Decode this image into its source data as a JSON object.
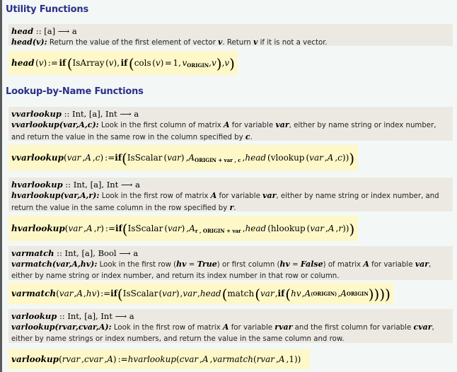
{
  "sections": [
    {
      "title": "Utility Functions",
      "functions": [
        {
          "name": "head",
          "signature": ":: [a] ⟶ a",
          "call": "head(v):",
          "description_parts": [
            {
              "text": " Return the value of the first element of vector ",
              "bold": false
            },
            {
              "text": "v",
              "bold": true
            },
            {
              "text": ".  Return ",
              "bold": false
            },
            {
              "text": "v",
              "bold": true
            },
            {
              "text": " if it is not a vector.",
              "bold": false
            }
          ],
          "definition": {
            "lhs": "head (v)",
            "assign": ":=",
            "rhs": "if (IsArray (v), if (cols (v) = 1, v_ORIGIN, v), v)",
            "subscript": "ORIGIN"
          }
        }
      ]
    },
    {
      "title": "Lookup-by-Name Functions",
      "functions": [
        {
          "name": "vvarlookup",
          "signature": ":: Int, [a], Int ⟶ a",
          "call": "vvarlookup(var,A,c):",
          "description_parts": [
            {
              "text": " Look in the first column of matrix ",
              "bold": false
            },
            {
              "text": "A",
              "bold": true
            },
            {
              "text": " for variable ",
              "bold": false
            },
            {
              "text": "var",
              "bold": true
            },
            {
              "text": ", either by name string or index number, and return the value in the same row in the column specified by ",
              "bold": false
            },
            {
              "text": "c",
              "bold": true
            },
            {
              "text": ".",
              "bold": false
            }
          ],
          "definition": {
            "lhs": "vvarlookup (var, A, c)",
            "assign": ":=",
            "rhs": "if (IsScalar (var), A_ORIGIN+var,c, head (vlookup (var, A, c)))",
            "subscript": "ORIGIN + var , c"
          }
        },
        {
          "name": "hvarlookup",
          "signature": ":: Int, [a], Int ⟶ a",
          "call": "hvarlookup(var,A,r):",
          "description_parts": [
            {
              "text": " Look in the first row of matrix ",
              "bold": false
            },
            {
              "text": "A",
              "bold": true
            },
            {
              "text": " for variable ",
              "bold": false
            },
            {
              "text": "var",
              "bold": true
            },
            {
              "text": ", either by name string or index number, and return the value in the same column in the row specified by ",
              "bold": false
            },
            {
              "text": "r",
              "bold": true
            },
            {
              "text": ".",
              "bold": false
            }
          ],
          "definition": {
            "lhs": "hvarlookup (var, A, r)",
            "assign": ":=",
            "rhs": "if (IsScalar (var), A_r,ORIGIN+var, head (hlookup (var, A, r)))",
            "subscript": "r , ORIGIN + var"
          }
        },
        {
          "name": "varmatch",
          "signature": ":: Int, [a], Bool ⟶ a",
          "call": "varmatch(var,A,hv):",
          "description_parts": [
            {
              "text": " Look in the first row (",
              "bold": false
            },
            {
              "text": "hv",
              "bold": true
            },
            {
              "text": " = ",
              "bold": false
            },
            {
              "text": "True",
              "bold": true
            },
            {
              "text": ") or first column (",
              "bold": false
            },
            {
              "text": "hv",
              "bold": true
            },
            {
              "text": " = ",
              "bold": false
            },
            {
              "text": "False",
              "bold": true
            },
            {
              "text": ") of matrix ",
              "bold": false
            },
            {
              "text": "A",
              "bold": true
            },
            {
              "text": " for variable ",
              "bold": false
            },
            {
              "text": "var",
              "bold": true
            },
            {
              "text": ", either by name string or index number, and return its index number in that row or column.",
              "bold": false
            }
          ],
          "definition": {
            "lhs": "varmatch (var, A, hv)",
            "assign": ":=",
            "rhs": "if (IsScalar (var), var, head (match (var, if (hv, A^(ORIGIN), A^ORIGIN^T))))",
            "superscript_col": "⟨ORIGIN⟩",
            "superscript_row": "ORIGIN"
          }
        },
        {
          "name": "varlookup",
          "signature": ":: Int, [a], Int ⟶ a",
          "call": "varlookup(rvar,cvar,A):",
          "description_parts": [
            {
              "text": " Look in the first row of matrix ",
              "bold": false
            },
            {
              "text": "A",
              "bold": true
            },
            {
              "text": " for variable ",
              "bold": false
            },
            {
              "text": "rvar",
              "bold": true
            },
            {
              "text": " and the first column for variable ",
              "bold": false
            },
            {
              "text": "cvar",
              "bold": true
            },
            {
              "text": ", either by name strings or index numbers, and return the value in the same column and row.",
              "bold": false
            }
          ],
          "definition": {
            "lhs": "varlookup (rvar, cvar, A)",
            "assign": ":=",
            "rhs": "hvarlookup (cvar, A, varmatch (rvar, A, 1))"
          }
        }
      ]
    }
  ],
  "labels": {
    "if": "if",
    "IsArray": "IsArray",
    "IsScalar": "IsScalar",
    "cols": "cols",
    "vlookup": "vlookup",
    "hlookup": "hlookup",
    "match": "match",
    "origin": "ORIGIN"
  },
  "colors": {
    "section_title": "#2b2f8a",
    "doc_box": "#ece9e3",
    "eq_box": "#fef8c8",
    "page_bg": "#f3f8f6"
  }
}
